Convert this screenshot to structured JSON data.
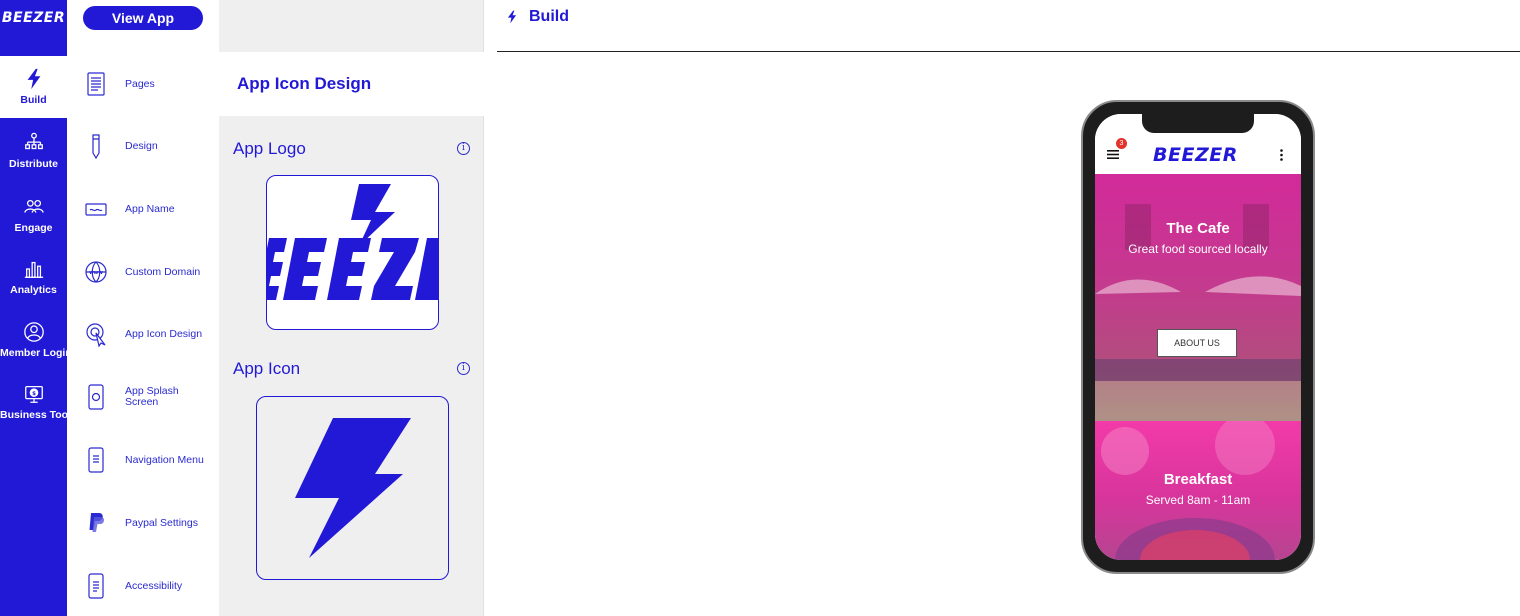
{
  "rail": {
    "logo": "BEEZER",
    "items": [
      {
        "label": "Build",
        "icon": "bolt-icon",
        "active": true
      },
      {
        "label": "Distribute",
        "icon": "org-chart-icon"
      },
      {
        "label": "Engage",
        "icon": "people-icon"
      },
      {
        "label": "Analytics",
        "icon": "bar-chart-icon"
      },
      {
        "label": "Member Login",
        "icon": "user-circle-icon"
      },
      {
        "label": "Business Tools",
        "icon": "dollar-monitor-icon"
      }
    ]
  },
  "menu": {
    "view_app": "View App",
    "items": [
      {
        "label": "Pages",
        "icon": "document-icon"
      },
      {
        "label": "Design",
        "icon": "pencil-icon"
      },
      {
        "label": "App Name",
        "icon": "card-icon"
      },
      {
        "label": "Custom Domain",
        "icon": "globe-www-icon"
      },
      {
        "label": "App Icon Design",
        "icon": "cursor-click-icon"
      },
      {
        "label": "App Splash Screen",
        "icon": "phone-splash-icon"
      },
      {
        "label": "Navigation Menu",
        "icon": "phone-menu-icon"
      },
      {
        "label": "Paypal Settings",
        "icon": "paypal-icon"
      },
      {
        "label": "Accessibility",
        "icon": "phone-accessibility-icon"
      }
    ]
  },
  "panel": {
    "title": "App Icon Design",
    "logo_section": "App Logo",
    "icon_section": "App Icon",
    "info": "i"
  },
  "main": {
    "breadcrumb": "Build"
  },
  "phone": {
    "brand": "BEEZER",
    "badge_count": "3",
    "hero_title": "The Cafe",
    "hero_subtitle": "Great food sourced locally",
    "about_button": "ABOUT US",
    "hero2_title": "Breakfast",
    "hero2_subtitle": "Served 8am - 11am"
  },
  "colors": {
    "brand_blue": "#2219d6",
    "panel_gray": "#efefef",
    "hero_pink": "#d22a9a",
    "badge_red": "#e0342c"
  }
}
